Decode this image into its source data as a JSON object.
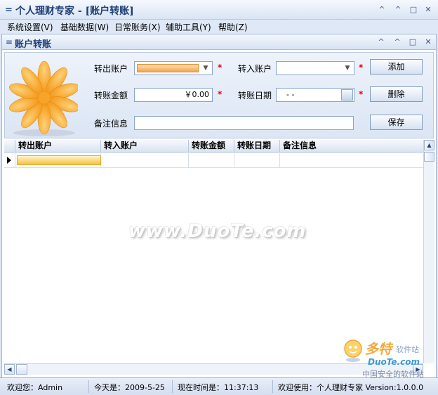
{
  "window": {
    "title": "个人理财专家 - [账户转账]",
    "buttons": {
      "min": "^",
      "restore": "^",
      "max": "□",
      "close": "✕"
    }
  },
  "menu": [
    {
      "label": "系统设置(V)"
    },
    {
      "label": "基础数据(W)"
    },
    {
      "label": "日常账务(X)"
    },
    {
      "label": "辅助工具(Y)"
    },
    {
      "label": "帮助(Z)"
    }
  ],
  "child": {
    "title": "账户转账",
    "buttons": {
      "min": "^",
      "restore": "^",
      "max": "□",
      "close": "✕"
    }
  },
  "form": {
    "from_account_label": "转出账户",
    "from_account_value": "",
    "to_account_label": "转入账户",
    "to_account_value": "",
    "amount_label": "转账金额",
    "amount_value": "￥0.00",
    "date_label": "转账日期",
    "date_value": "- -",
    "remark_label": "备注信息",
    "remark_value": "",
    "required_mark": "*",
    "add_button": "添加",
    "delete_button": "删除",
    "save_button": "保存"
  },
  "grid": {
    "columns": [
      "转出账户",
      "转入账户",
      "转账金额",
      "转账日期",
      "备注信息"
    ],
    "rows": [
      [
        "",
        "",
        "",
        "",
        ""
      ]
    ]
  },
  "watermark": "www.DuoTe.com",
  "corner_logo": {
    "line1": "多特",
    "line2": "软件站",
    "line3": "DuoTe.com",
    "line4": "中国安全的软件站"
  },
  "status": {
    "welcome": "欢迎您：Admin",
    "today": "今天是：2009-5-25",
    "time": "现在时间是：11:37:13",
    "version": "欢迎使用：个人理财专家 Version:1.0.0.0"
  },
  "colors": {
    "accent_orange": "#f6a24c",
    "required_red": "#e00000",
    "title_blue": "#1e3e75"
  }
}
